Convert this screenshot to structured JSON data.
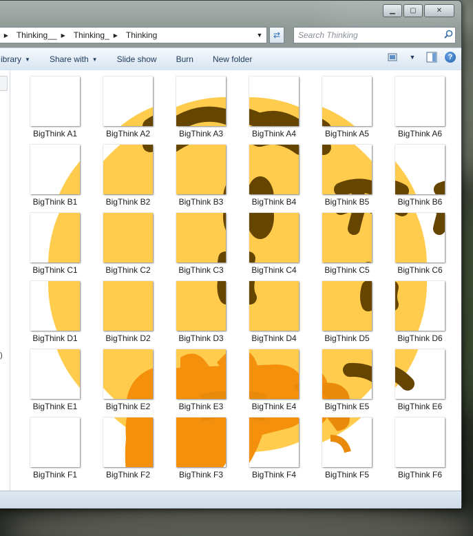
{
  "window": {
    "caption_buttons": [
      {
        "name": "minimize-button",
        "glyph": "▁"
      },
      {
        "name": "maximize-button",
        "glyph": "▢"
      },
      {
        "name": "close-button",
        "glyph": "✕"
      }
    ]
  },
  "address": {
    "breadcrumbs": [
      "_",
      "Thinking__",
      "Thinking_",
      "Thinking"
    ],
    "dropdown_glyph": "▼",
    "refresh_glyph": "⇄"
  },
  "search": {
    "placeholder": "Search Thinking",
    "icon": "search-icon"
  },
  "toolbar": {
    "items": [
      {
        "label": "ibrary",
        "dropdown": true
      },
      {
        "label": "Share with",
        "dropdown": true
      },
      {
        "label": "Slide show",
        "dropdown": false
      },
      {
        "label": "Burn",
        "dropdown": false
      },
      {
        "label": "New folder",
        "dropdown": false
      }
    ],
    "right_icons": [
      "change-view-icon",
      "preview-pane-icon",
      "help-icon"
    ],
    "help_glyph": "?"
  },
  "nav_pane": {
    "mark": ")"
  },
  "colors": {
    "emoji_yellow": "#FFCC4D",
    "emoji_dark": "#664500",
    "emoji_orange": "#F4900C",
    "emoji_orange_dark": "#E98A0A"
  },
  "files": {
    "rows": [
      "A",
      "B",
      "C",
      "D",
      "E",
      "F"
    ],
    "cols": [
      1,
      2,
      3,
      4,
      5,
      6
    ],
    "items": [
      {
        "row": "A",
        "col": 1,
        "label": "BigThink A1"
      },
      {
        "row": "A",
        "col": 2,
        "label": "BigThink A2"
      },
      {
        "row": "A",
        "col": 3,
        "label": "BigThink A3"
      },
      {
        "row": "A",
        "col": 4,
        "label": "BigThink A4"
      },
      {
        "row": "A",
        "col": 5,
        "label": "BigThink A5"
      },
      {
        "row": "A",
        "col": 6,
        "label": "BigThink A6"
      },
      {
        "row": "B",
        "col": 1,
        "label": "BigThink B1"
      },
      {
        "row": "B",
        "col": 2,
        "label": "BigThink B2"
      },
      {
        "row": "B",
        "col": 3,
        "label": "BigThink B3"
      },
      {
        "row": "B",
        "col": 4,
        "label": "BigThink B4"
      },
      {
        "row": "B",
        "col": 5,
        "label": "BigThink B5"
      },
      {
        "row": "B",
        "col": 6,
        "label": "BigThink B6"
      },
      {
        "row": "C",
        "col": 1,
        "label": "BigThink C1"
      },
      {
        "row": "C",
        "col": 2,
        "label": "BigThink C2"
      },
      {
        "row": "C",
        "col": 3,
        "label": "BigThink C3"
      },
      {
        "row": "C",
        "col": 4,
        "label": "BigThink C4"
      },
      {
        "row": "C",
        "col": 5,
        "label": "BigThink C5"
      },
      {
        "row": "C",
        "col": 6,
        "label": "BigThink C6"
      },
      {
        "row": "D",
        "col": 1,
        "label": "BigThink D1"
      },
      {
        "row": "D",
        "col": 2,
        "label": "BigThink D2"
      },
      {
        "row": "D",
        "col": 3,
        "label": "BigThink D3"
      },
      {
        "row": "D",
        "col": 4,
        "label": "BigThink D4"
      },
      {
        "row": "D",
        "col": 5,
        "label": "BigThink D5"
      },
      {
        "row": "D",
        "col": 6,
        "label": "BigThink D6"
      },
      {
        "row": "E",
        "col": 1,
        "label": "BigThink E1"
      },
      {
        "row": "E",
        "col": 2,
        "label": "BigThink E2"
      },
      {
        "row": "E",
        "col": 3,
        "label": "BigThink E3"
      },
      {
        "row": "E",
        "col": 4,
        "label": "BigThink E4"
      },
      {
        "row": "E",
        "col": 5,
        "label": "BigThink E5"
      },
      {
        "row": "E",
        "col": 6,
        "label": "BigThink E6"
      },
      {
        "row": "F",
        "col": 1,
        "label": "BigThink F1"
      },
      {
        "row": "F",
        "col": 2,
        "label": "BigThink F2"
      },
      {
        "row": "F",
        "col": 3,
        "label": "BigThink F3"
      },
      {
        "row": "F",
        "col": 4,
        "label": "BigThink F4"
      },
      {
        "row": "F",
        "col": 5,
        "label": "BigThink F5"
      },
      {
        "row": "F",
        "col": 6,
        "label": "BigThink F6"
      }
    ]
  }
}
